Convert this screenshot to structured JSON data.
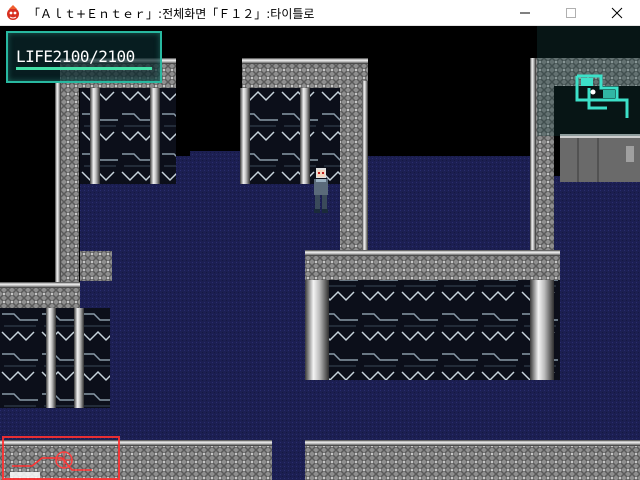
{
  "window": {
    "title": "「Ａｌｔ+Ｅｎｔｅｒ」:전체화면「Ｆ１２」:타이틀로",
    "icon": "red-game-icon",
    "buttons": [
      "minimize",
      "maximize",
      "close"
    ]
  },
  "hud": {
    "life_label": "LIFE",
    "life_text": "LIFE2100/2100",
    "life_current": 2100,
    "life_max": 2100,
    "life_fraction": 1.0,
    "border_color": "#28b8a0"
  },
  "scene": {
    "floor_color": "#1c1f52",
    "wall_color": "#9a9a9a",
    "accent_color": "#3ce0c8"
  },
  "overlay": {
    "bottom_left_color": "#ff3030"
  }
}
